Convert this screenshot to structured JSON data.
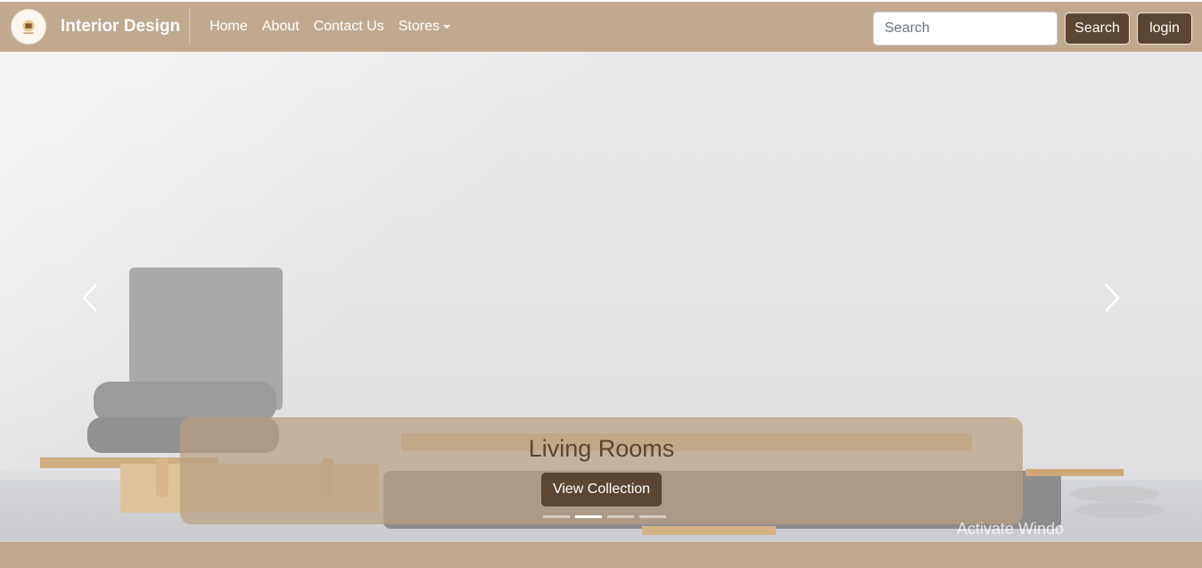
{
  "navbar": {
    "brand": "Interior Design",
    "logo_icon": "brand-logo-icon",
    "links": [
      {
        "label": "Home"
      },
      {
        "label": "About"
      },
      {
        "label": "Contact Us"
      },
      {
        "label": "Stores"
      }
    ],
    "search_placeholder": "Search",
    "search_button": "Search",
    "login_button": "login"
  },
  "carousel": {
    "prev_icon": "chevron-left-icon",
    "next_icon": "chevron-right-icon",
    "caption_title": "Living Rooms",
    "caption_button": "View Collection",
    "slide_count": 4,
    "active_slide": 2
  },
  "watermark": "Activate Windo",
  "colors": {
    "nav_bg": "#c1a98e",
    "button_dark": "#5a4632",
    "caption_bg": "#b9a082"
  }
}
